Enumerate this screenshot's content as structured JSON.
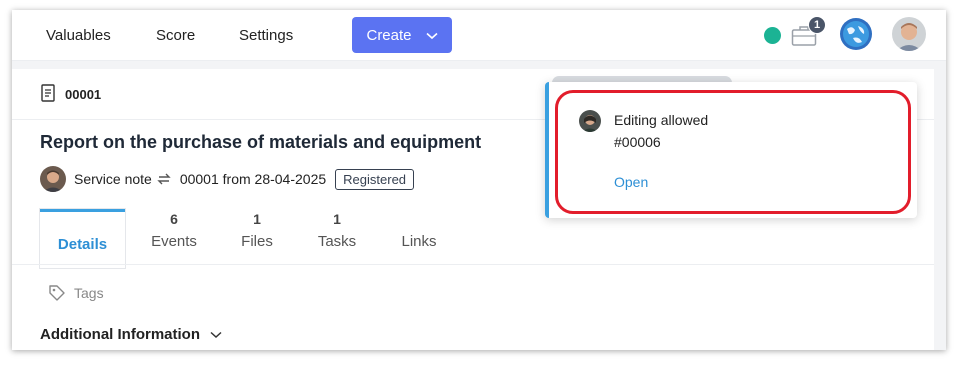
{
  "nav": {
    "items": [
      "Valuables",
      "Score",
      "Settings"
    ],
    "create_label": "Create"
  },
  "notifications": {
    "count": "1"
  },
  "document": {
    "id": "00001",
    "title": "Report on the purchase of materials and equipment",
    "type": "Service note",
    "number_date": "00001 from 28-04-2025",
    "status": "Registered"
  },
  "tabs": [
    {
      "count": "",
      "label": "Details"
    },
    {
      "count": "6",
      "label": "Events"
    },
    {
      "count": "1",
      "label": "Files"
    },
    {
      "count": "1",
      "label": "Tasks"
    },
    {
      "count": "",
      "label": "Links"
    }
  ],
  "tags_label": "Tags",
  "additional_info_label": "Additional Information",
  "popover": {
    "title": "Editing allowed",
    "number": "#00006",
    "open_label": "Open"
  },
  "colors": {
    "accent": "#5b73f2",
    "link": "#2d8fd5",
    "status_online": "#1bb394",
    "highlight": "#e21d2b"
  }
}
